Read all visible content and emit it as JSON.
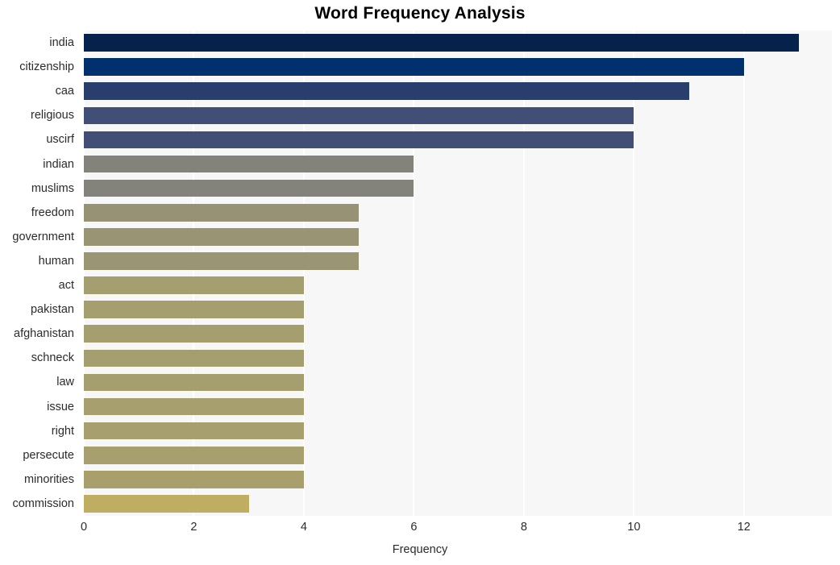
{
  "chart_data": {
    "type": "bar",
    "orientation": "horizontal",
    "title": "Word Frequency Analysis",
    "xlabel": "Frequency",
    "ylabel": "",
    "xlim": [
      0,
      13.6
    ],
    "xticks": [
      0,
      2,
      4,
      6,
      8,
      10,
      12
    ],
    "xtick_labels": [
      "0",
      "2",
      "4",
      "6",
      "8",
      "10",
      "12"
    ],
    "grid": "vertical-only",
    "legend": "none",
    "categories": [
      "india",
      "citizenship",
      "caa",
      "religious",
      "uscirf",
      "indian",
      "muslims",
      "freedom",
      "government",
      "human",
      "act",
      "pakistan",
      "afghanistan",
      "schneck",
      "law",
      "issue",
      "right",
      "persecute",
      "minorities",
      "commission"
    ],
    "values": [
      13,
      12,
      11,
      10,
      10,
      6,
      6,
      5,
      5,
      5,
      4,
      4,
      4,
      4,
      4,
      4,
      4,
      4,
      4,
      3
    ],
    "bar_colors": [
      "#04224c",
      "#00316e",
      "#2a3e6e",
      "#414f76",
      "#414f76",
      "#83827b",
      "#83827b",
      "#979275",
      "#999474",
      "#9a9572",
      "#a59e6f",
      "#a59e6f",
      "#a59e6f",
      "#a59e6f",
      "#a59e6f",
      "#a79f6d",
      "#a79f6d",
      "#a79f6d",
      "#a89f6c",
      "#bfae61"
    ],
    "plot_background": "#f7f7f7",
    "gridline_color": "#ffffff",
    "figure_background": "#ffffff"
  }
}
